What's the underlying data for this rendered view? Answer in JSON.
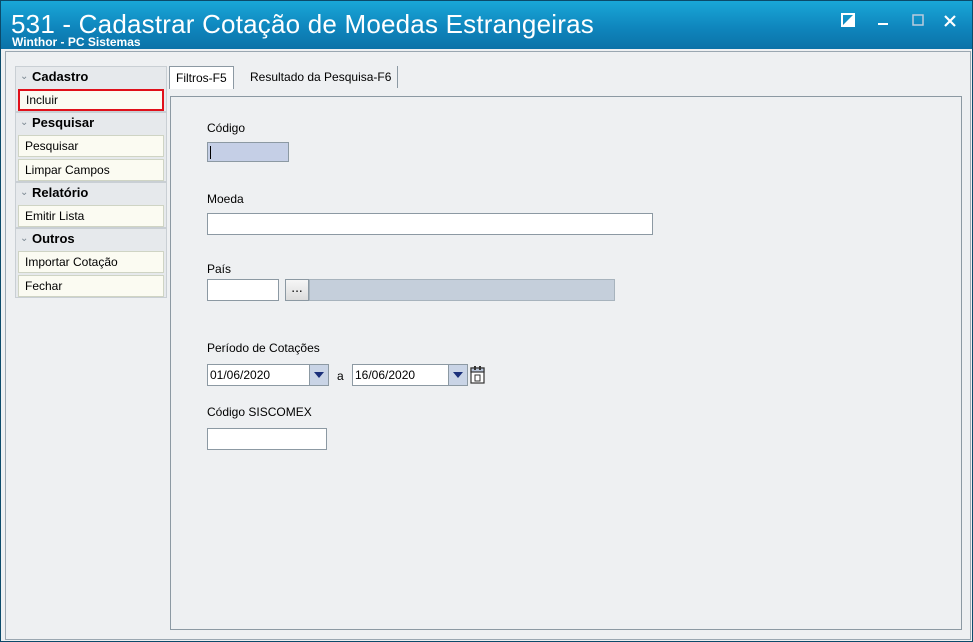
{
  "window": {
    "title": "531 - Cadastrar Cotação de Moedas Estrangeiras",
    "subtitle": "Winthor - PC Sistemas"
  },
  "sidebar": {
    "groups": [
      {
        "title": "Cadastro",
        "items": [
          "Incluir"
        ]
      },
      {
        "title": "Pesquisar",
        "items": [
          "Pesquisar",
          "Limpar Campos"
        ]
      },
      {
        "title": "Relatório",
        "items": [
          "Emitir Lista"
        ]
      },
      {
        "title": "Outros",
        "items": [
          "Importar Cotação",
          "Fechar"
        ]
      }
    ]
  },
  "tabs": [
    {
      "label": "Filtros-F5",
      "active": true
    },
    {
      "label": "Resultado da Pesquisa-F6",
      "active": false
    }
  ],
  "form": {
    "codigo": {
      "label": "Código",
      "value": ""
    },
    "moeda": {
      "label": "Moeda",
      "value": ""
    },
    "pais": {
      "label": "País",
      "value": "",
      "button": "...",
      "description": ""
    },
    "periodo": {
      "label": "Período de Cotações",
      "start": "01/06/2020",
      "separator": "a",
      "end": "16/06/2020"
    },
    "siscomex": {
      "label": "Código SISCOMEX",
      "value": ""
    }
  },
  "colors": {
    "title_bar": "#0f86bd",
    "highlight": "#e0101a",
    "readonly_field": "#c5cfdb"
  }
}
